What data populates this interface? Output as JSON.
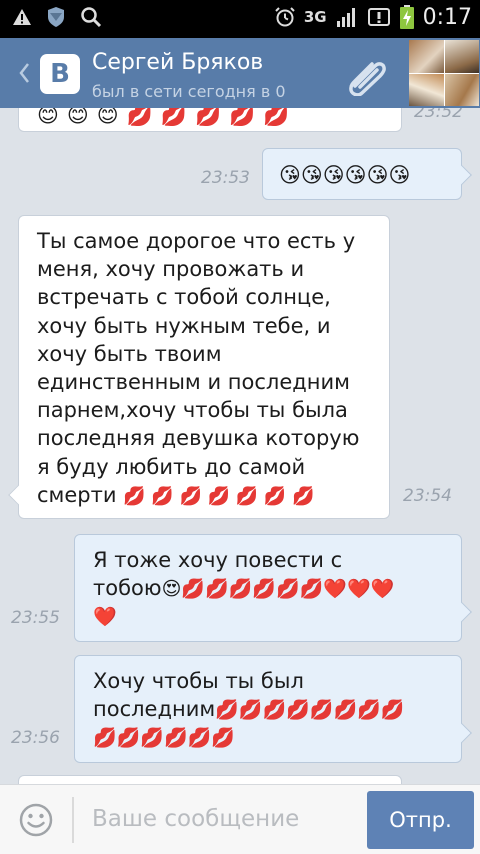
{
  "statusbar": {
    "left_icons": [
      "warning-icon",
      "shield-icon",
      "search-icon"
    ],
    "right_icons": [
      "alarm-icon",
      "signal-icon",
      "notification-icon",
      "battery-charging-icon"
    ],
    "network": "3G",
    "time": "0:17"
  },
  "header": {
    "app_logo": "В",
    "contact_name": "Сергей Бряков",
    "contact_status": "был в сети сегодня в 0",
    "attach_icon": "paperclip-icon"
  },
  "messages": [
    {
      "direction": "in",
      "text": "",
      "emoji": "😊😊😊💋💋💋💋💋",
      "time": "23:52"
    },
    {
      "direction": "out",
      "text": "",
      "emoji": "😘😘😘😘😘😘",
      "time": "23:53"
    },
    {
      "direction": "in",
      "lines": [
        "Ты самое дорогое что есть у",
        "меня, хочу провожать и",
        "встречать с тобой солнце,",
        "хочу быть нужным тебе, и",
        "хочу быть твоим",
        "единственным и последним",
        "парнем,хочу чтобы ты была",
        "последняя девушка которую",
        "я буду любить до самой"
      ],
      "last_line": "смерти",
      "emoji": "💋 💋 💋 💋 💋 💋 💋",
      "time": "23:54"
    },
    {
      "direction": "out",
      "line1": "Я тоже хочу повести с",
      "line2": "тобою",
      "emoji_line2": "😍💋💋💋💋💋💋❤️❤️❤️",
      "emoji_line3": "❤️",
      "time": "23:55"
    },
    {
      "direction": "out",
      "line1": "Хочу чтобы ты был",
      "line2": "последним",
      "emoji_line2": "💋💋💋💋💋💋💋💋",
      "emoji_line3": "💋💋💋💋💋💋",
      "time": "23:56"
    }
  ],
  "composer": {
    "placeholder": "Ваше сообщение",
    "send_label": "Отпр.",
    "emoji_icon": "smiley-icon"
  },
  "colors": {
    "header_bg": "#587ca9",
    "chat_bg": "#dde2e8",
    "outgoing_bubble": "#e6f0fa",
    "send_button": "#5e82b5"
  }
}
